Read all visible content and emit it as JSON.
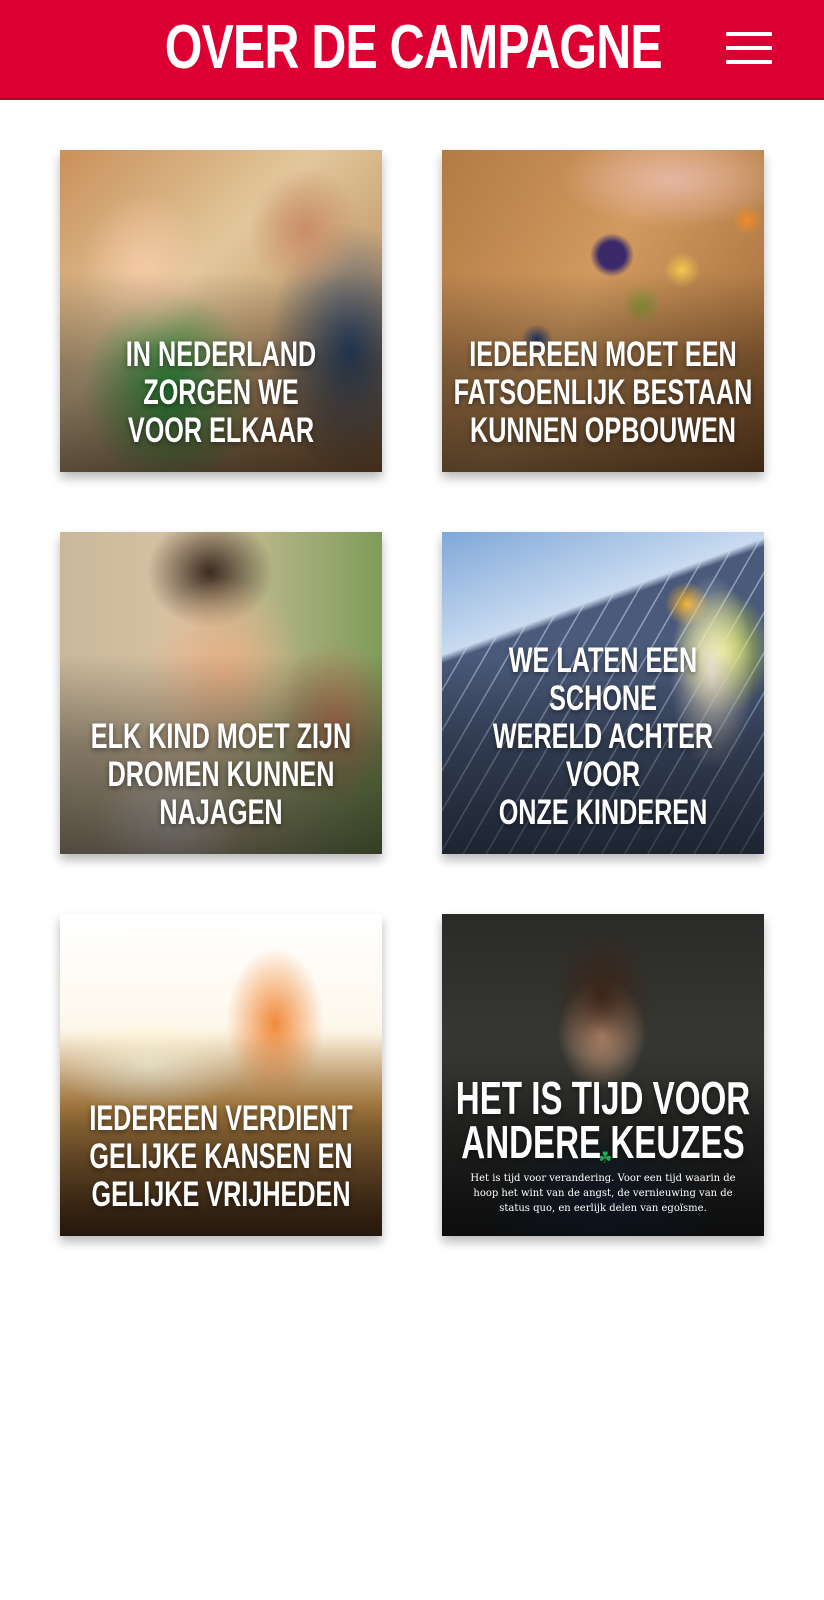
{
  "header": {
    "title": "OVER DE CAMPAGNE",
    "menu_icon": "hamburger-menu-icon",
    "background_color": "#dc0032"
  },
  "cards": [
    {
      "title": "IN NEDERLAND ZORGEN WE\nVOOR ELKAAR"
    },
    {
      "title": "IEDEREEN MOET EEN\nFATSOENLIJK BESTAAN\nKUNNEN OPBOUWEN"
    },
    {
      "title": "ELK KIND MOET ZIJN\nDROMEN KUNNEN\nNAJAGEN"
    },
    {
      "title": "WE LATEN EEN SCHONE\nWERELD ACHTER VOOR\nONZE KINDEREN"
    },
    {
      "title": "IEDEREEN VERDIENT\nGELIJKE KANSEN EN\nGELIJKE VRIJHEDEN"
    },
    {
      "title": "HET IS TIJD VOOR\nANDERE KEUZES",
      "text": "Het is tijd voor verandering. Voor een tijd waarin de hoop het wint van de angst, de vernieuwing van de status quo, en eerlijk delen van egoïsme."
    }
  ]
}
